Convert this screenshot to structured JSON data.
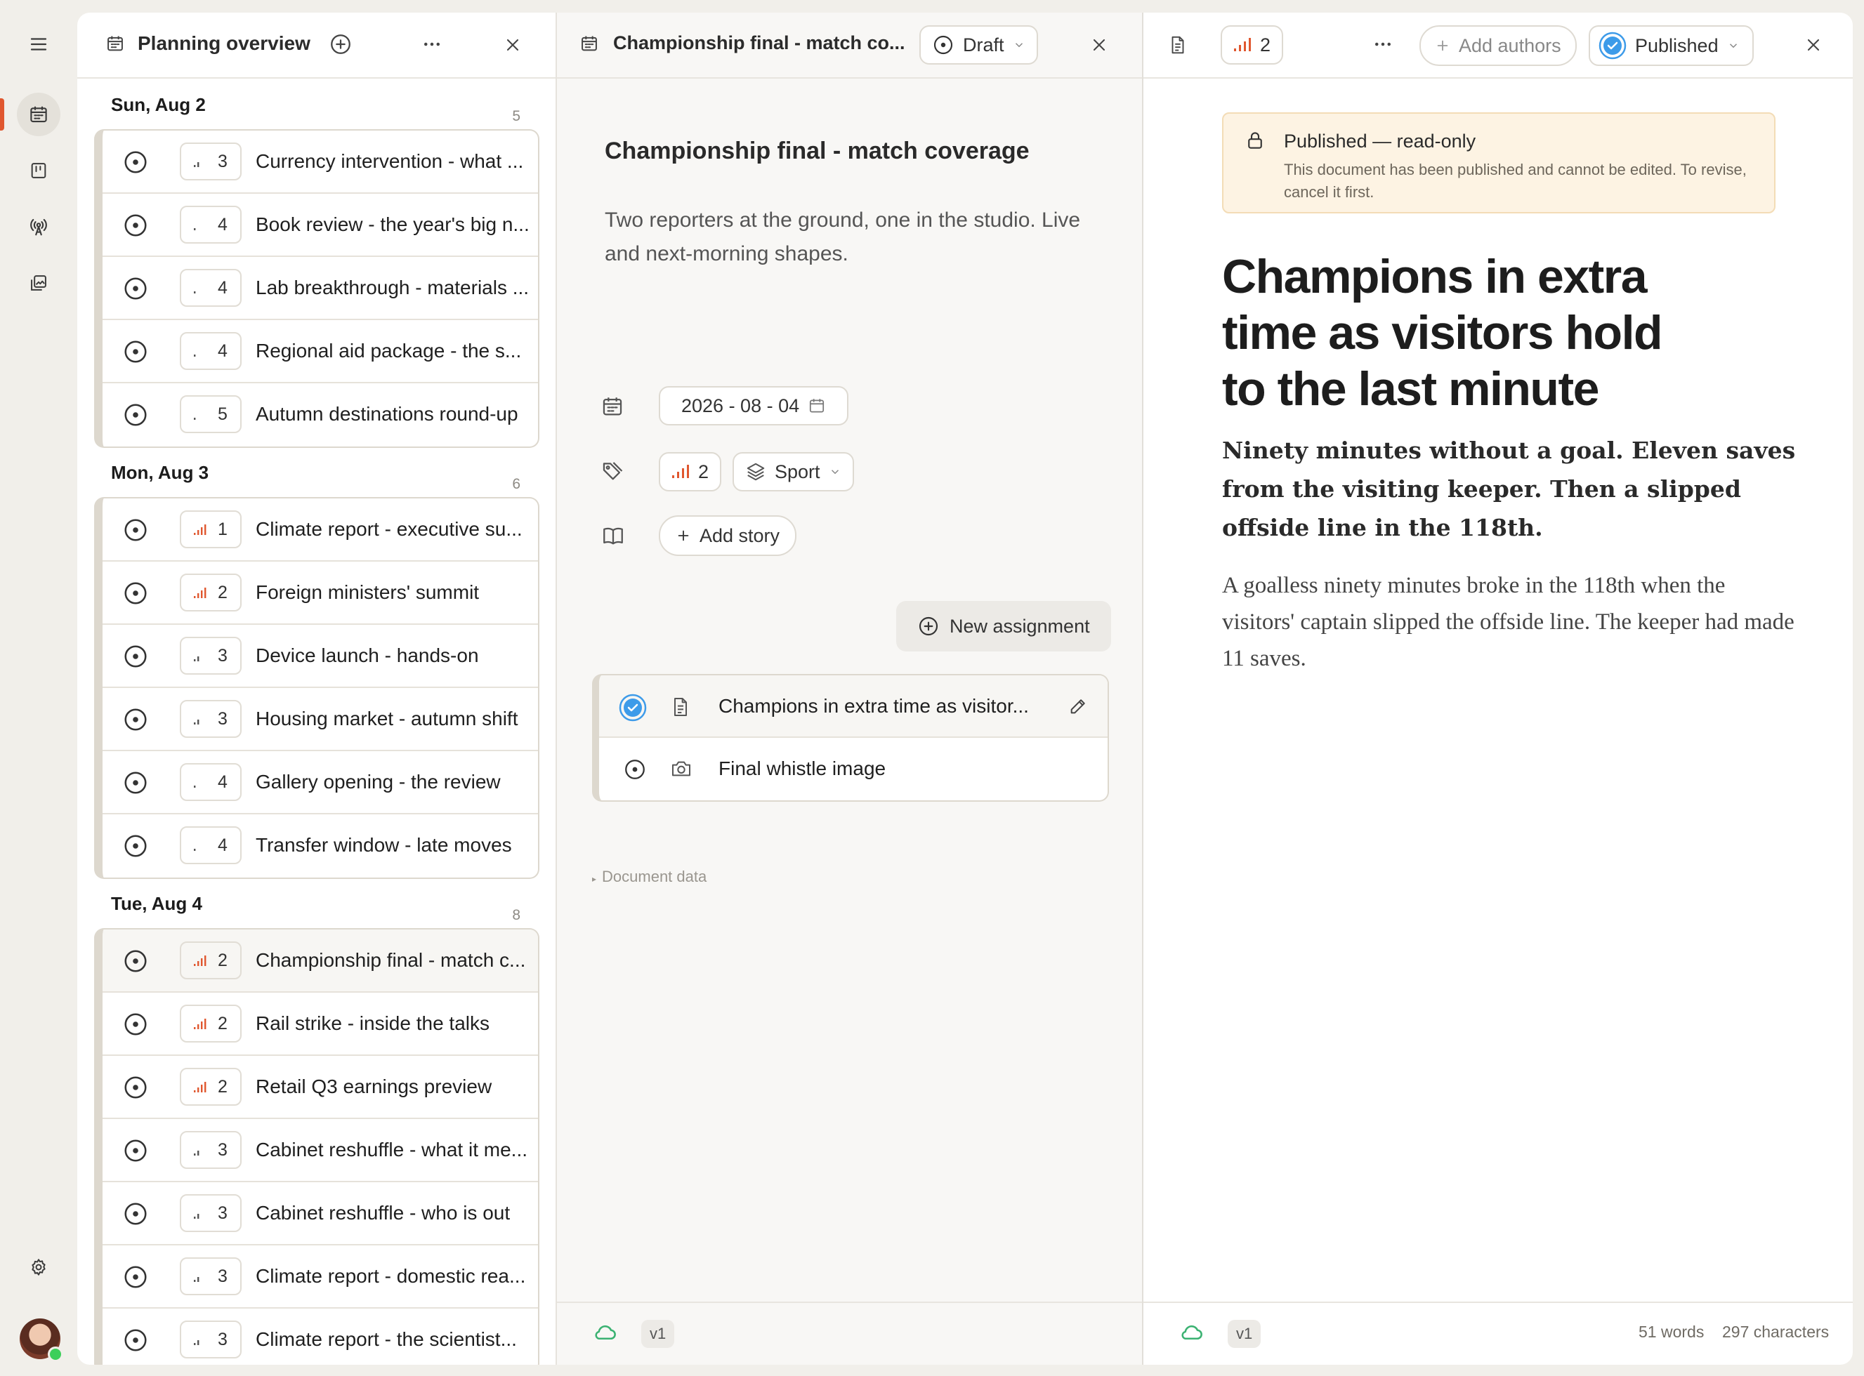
{
  "planning": {
    "title": "Planning overview",
    "days": [
      {
        "label": "Sun, Aug 2",
        "count": "5",
        "items": [
          {
            "priority": "3",
            "title": "Currency intervention - what ...",
            "high": false
          },
          {
            "priority": "4",
            "title": "Book review - the year's big n...",
            "high": false
          },
          {
            "priority": "4",
            "title": "Lab breakthrough - materials ...",
            "high": false
          },
          {
            "priority": "4",
            "title": "Regional aid package - the s...",
            "high": false
          },
          {
            "priority": "5",
            "title": "Autumn destinations round-up",
            "high": false
          }
        ]
      },
      {
        "label": "Mon, Aug 3",
        "count": "6",
        "items": [
          {
            "priority": "1",
            "title": "Climate report - executive su...",
            "high": true
          },
          {
            "priority": "2",
            "title": "Foreign ministers' summit",
            "high": true
          },
          {
            "priority": "3",
            "title": "Device launch - hands-on",
            "high": false
          },
          {
            "priority": "3",
            "title": "Housing market - autumn shift",
            "high": false
          },
          {
            "priority": "4",
            "title": "Gallery opening - the review",
            "high": false
          },
          {
            "priority": "4",
            "title": "Transfer window - late moves",
            "high": false
          }
        ]
      },
      {
        "label": "Tue, Aug 4",
        "count": "8",
        "items": [
          {
            "priority": "2",
            "title": "Championship final - match c...",
            "high": true,
            "selected": true
          },
          {
            "priority": "2",
            "title": "Rail strike - inside the talks",
            "high": true
          },
          {
            "priority": "2",
            "title": "Retail Q3 earnings preview",
            "high": true
          },
          {
            "priority": "3",
            "title": "Cabinet reshuffle - what it me...",
            "high": false
          },
          {
            "priority": "3",
            "title": "Cabinet reshuffle - who is out",
            "high": false
          },
          {
            "priority": "3",
            "title": "Climate report - domestic rea...",
            "high": false
          },
          {
            "priority": "3",
            "title": "Climate report - the scientist...",
            "high": false
          }
        ]
      }
    ]
  },
  "planning_item": {
    "header_title": "Championship final - match co...",
    "status": "Draft",
    "title": "Championship final - match coverage",
    "description": "Two reporters at the ground, one in the studio. Live and next-morning shapes.",
    "date": "2026 - 08 - 04",
    "priority": "2",
    "section": "Sport",
    "add_story": "Add story",
    "new_assignment": "New assignment",
    "assignments": [
      {
        "title": "Champions in extra time as visitor...",
        "done": true,
        "kind": "text"
      },
      {
        "title": "Final whistle image",
        "done": false,
        "kind": "photo"
      }
    ],
    "document_data": "Document data",
    "version": "v1"
  },
  "article": {
    "priority": "2",
    "add_authors": "Add authors",
    "status": "Published",
    "notice_title": "Published — read-only",
    "notice_body": "This document has been published and cannot be edited. To revise, cancel it first.",
    "headline": "Champions in extra time as visitors hold to the last minute",
    "standfirst": "Ninety minutes without a goal. Eleven saves from the visiting keeper. Then a slipped offside line in the 118th.",
    "body": "A goalless ninety minutes broke in the 118th when the visitors' captain slipped the offside line. The keeper had made 11 saves.",
    "version": "v1",
    "words": "51 words",
    "characters": "297 characters"
  },
  "colors": {
    "accent_red": "#e0572f",
    "published_blue": "#3d9be9",
    "cloud_green": "#3bb272",
    "notice_bg": "#fdf3e3"
  }
}
